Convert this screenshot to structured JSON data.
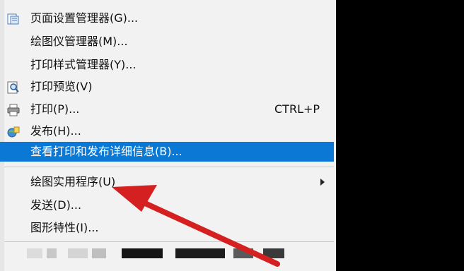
{
  "menu": {
    "items": [
      {
        "label": "页面设置管理器(G)...",
        "icon": "page-setup-icon"
      },
      {
        "label": "绘图仪管理器(M)..."
      },
      {
        "label": "打印样式管理器(Y)..."
      },
      {
        "label": "打印预览(V)",
        "icon": "print-preview-icon"
      },
      {
        "label": "打印(P)...",
        "shortcut": "CTRL+P",
        "icon": "printer-icon"
      },
      {
        "label": "发布(H)...",
        "icon": "publish-icon"
      },
      {
        "label": "查看打印和发布详细信息(B)...",
        "selected": true
      },
      {
        "label": "绘图实用程序(U)",
        "has_submenu": true
      },
      {
        "label": "发送(D)..."
      },
      {
        "label": "图形特性(I)..."
      }
    ]
  },
  "colors": {
    "selection": "#0a78d4",
    "arrow": "#d42020",
    "menu_bg": "#f2f2f2"
  }
}
